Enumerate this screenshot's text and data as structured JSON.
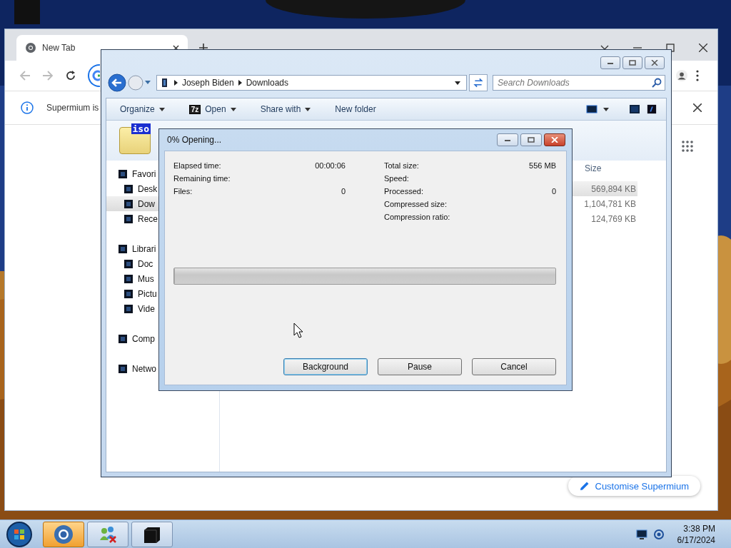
{
  "browser": {
    "tab": {
      "title": "New Tab"
    },
    "infobar": {
      "text": "Supermium is"
    },
    "customise_button": {
      "label": "Customise Supermium"
    }
  },
  "explorer": {
    "breadcrumb": [
      "Joseph Biden",
      "Downloads"
    ],
    "search": {
      "placeholder": "Search Downloads"
    },
    "toolbar": [
      {
        "label": "Organize",
        "dropdown": true
      },
      {
        "label": "Open",
        "badge": "7z",
        "dropdown": true
      },
      {
        "label": "Share with",
        "dropdown": true
      },
      {
        "label": "New folder",
        "dropdown": false
      }
    ],
    "folder_badge": "iso",
    "nav": [
      {
        "label": "Favori",
        "selected": false,
        "children": [
          {
            "label": "Desk",
            "selected": false
          },
          {
            "label": "Dow",
            "selected": true
          },
          {
            "label": "Rece",
            "selected": false
          }
        ]
      },
      {
        "label": "Librari",
        "selected": false,
        "children": [
          {
            "label": "Doc",
            "selected": false
          },
          {
            "label": "Mus",
            "selected": false
          },
          {
            "label": "Pictu",
            "selected": false
          },
          {
            "label": "Vide",
            "selected": false
          }
        ]
      },
      {
        "label": "Comp",
        "selected": false
      },
      {
        "label": "Netwo",
        "selected": false
      }
    ],
    "column_header": "Size",
    "rows": [
      {
        "size": "569,894 KB",
        "selected": true
      },
      {
        "size": "1,104,781 KB",
        "selected": false
      },
      {
        "size": "124,769 KB",
        "selected": false
      }
    ]
  },
  "dialog": {
    "title": "0% Opening...",
    "left": [
      {
        "label": "Elapsed time:",
        "value": "00:00:06"
      },
      {
        "label": "Remaining time:"
      },
      {
        "label": "Files:",
        "value": "0"
      }
    ],
    "right": [
      {
        "label": "Total size:",
        "value": "556 MB"
      },
      {
        "label": "Speed:"
      },
      {
        "label": "Processed:",
        "value": "0"
      },
      {
        "label": "Compressed size:"
      },
      {
        "label": "Compression ratio:"
      }
    ],
    "progress": {
      "level": 0
    },
    "buttons": [
      {
        "label": "Background",
        "default": true
      },
      {
        "label": "Pause",
        "default": false
      },
      {
        "label": "Cancel",
        "default": false
      }
    ]
  },
  "taskbar": {
    "apps": [
      {
        "kind": "browser",
        "selected": true
      },
      {
        "kind": "people",
        "selected": false
      },
      {
        "kind": "library",
        "selected": false
      }
    ],
    "clock": {
      "time": "3:38 PM",
      "date": "6/17/2024"
    }
  }
}
